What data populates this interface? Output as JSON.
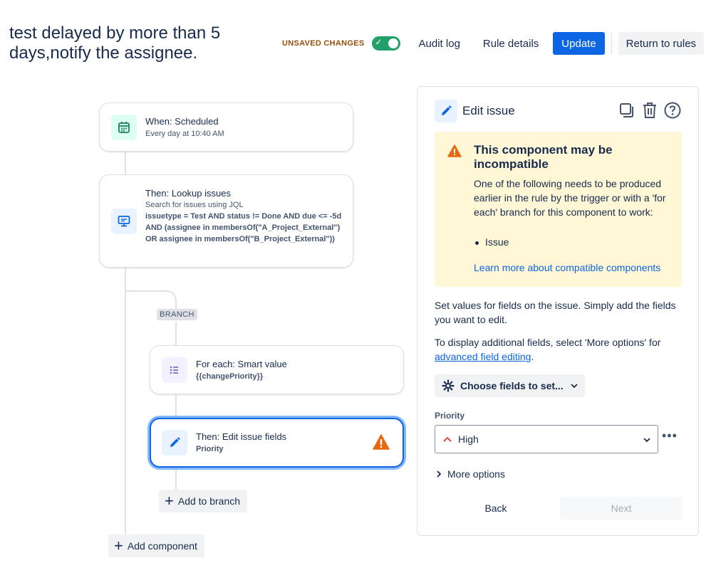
{
  "header": {
    "title": "test delayed by more than 5 days,notify the assignee.",
    "unsaved_label": "UNSAVED CHANGES",
    "toggle_on": true,
    "audit_log": "Audit log",
    "rule_details": "Rule details",
    "update": "Update",
    "return": "Return to rules"
  },
  "canvas": {
    "trigger": {
      "title": "When: Scheduled",
      "sub": "Every day at 10:40 AM",
      "icon": "calendar-icon"
    },
    "lookup": {
      "title": "Then: Lookup issues",
      "sub": "Search for issues using JQL",
      "jql": "issuetype = Test AND status != Done AND due <= -5d AND (assignee in membersOf(\"A_Project_External\") OR assignee in membersOf(\"B_Project_External\"))",
      "icon": "monitor-icon"
    },
    "branch_label": "BRANCH",
    "for_each": {
      "title": "For each: Smart value",
      "sub": "{{changePriority}}",
      "icon": "list-icon"
    },
    "edit": {
      "title": "Then: Edit issue fields",
      "sub": "Priority",
      "icon": "pencil-icon",
      "warning_icon": "warning-icon"
    },
    "add_to_branch": "Add to branch",
    "add_component": "Add component"
  },
  "panel": {
    "title": "Edit issue",
    "warning": {
      "title": "This component may be incompatible",
      "body": "One of the following needs to be produced earlier in the rule by the trigger or with a 'for each' branch for this component to work:",
      "items": [
        "Issue"
      ],
      "link": "Learn more about compatible components"
    },
    "desc1": "Set values for fields on the issue. Simply add the fields you want to edit.",
    "desc2_prefix": "To display additional fields, select 'More options' for ",
    "desc2_link": "advanced field editing",
    "desc2_suffix": ".",
    "choose_fields": "Choose fields to set...",
    "priority_label": "Priority",
    "priority_value": "High",
    "more_options": "More options",
    "back": "Back",
    "next": "Next"
  },
  "colors": {
    "primary": "#0c66e4",
    "toggle_green": "#22a06b",
    "warning_bg": "#fff7d6",
    "warning_orange": "#e56910"
  }
}
